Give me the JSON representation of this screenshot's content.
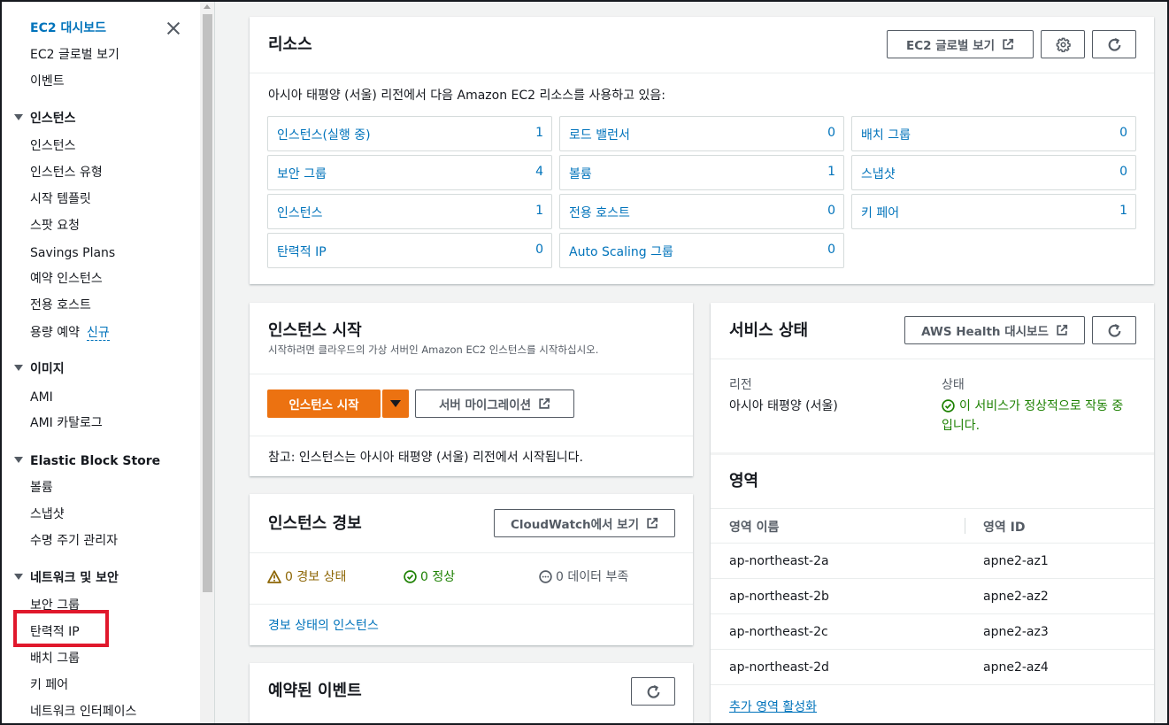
{
  "sidebar": {
    "items_top": [
      "EC2 대시보드",
      "EC2 글로벌 보기",
      "이벤트"
    ],
    "sections": [
      {
        "title": "인스턴스",
        "items": [
          "인스턴스",
          "인스턴스 유형",
          "시작 템플릿",
          "스팟 요청",
          "Savings Plans",
          "예약 인스턴스",
          "전용 호스트",
          "용량 예약"
        ]
      },
      {
        "title": "이미지",
        "items": [
          "AMI",
          "AMI 카탈로그"
        ]
      },
      {
        "title": "Elastic Block Store",
        "items": [
          "볼륨",
          "스냅샷",
          "수명 주기 관리자"
        ]
      },
      {
        "title": "네트워크 및 보안",
        "items": [
          "보안 그룹",
          "탄력적 IP",
          "배치 그룹",
          "키 페어",
          "네트워크 인터페이스"
        ]
      }
    ],
    "new_badge": "신규"
  },
  "resources": {
    "title": "리소스",
    "global_view_button": "EC2 글로벌 보기",
    "description": "아시아 태평양 (서울) 리전에서 다음 Amazon EC2 리소스를 사용하고 있음:",
    "items": [
      {
        "label": "인스턴스(실행 중)",
        "count": "1"
      },
      {
        "label": "로드 밸런서",
        "count": "0"
      },
      {
        "label": "배치 그룹",
        "count": "0"
      },
      {
        "label": "보안 그룹",
        "count": "4"
      },
      {
        "label": "볼륨",
        "count": "1"
      },
      {
        "label": "스냅샷",
        "count": "0"
      },
      {
        "label": "인스턴스",
        "count": "1"
      },
      {
        "label": "전용 호스트",
        "count": "0"
      },
      {
        "label": "키 페어",
        "count": "1"
      },
      {
        "label": "탄력적 IP",
        "count": "0"
      },
      {
        "label": "Auto Scaling 그룹",
        "count": "0"
      }
    ]
  },
  "launch": {
    "title": "인스턴스 시작",
    "subtitle": "시작하려면 클라우드의 가상 서버인 Amazon EC2 인스턴스를 시작하십시오.",
    "launch_button": "인스턴스 시작",
    "migrate_button": "서버 마이그레이션",
    "note": "참고: 인스턴스는 아시아 태평양 (서울) 리전에서 시작됩니다."
  },
  "alarms": {
    "title": "인스턴스 경보",
    "cloudwatch_button": "CloudWatch에서 보기",
    "alarm_state": "0 경보 상태",
    "ok_state": "0 정상",
    "insufficient_state": "0 데이터 부족",
    "alarm_link": "경보 상태의 인스턴스"
  },
  "events": {
    "title": "예약된 이벤트"
  },
  "service": {
    "title": "서비스 상태",
    "health_button": "AWS Health 대시보드",
    "region_label": "리전",
    "region_value": "아시아 태평양 (서울)",
    "status_label": "상태",
    "status_line1": "이 서비스가 정상적으로 작동 중",
    "status_line2": "입니다.",
    "zones_title": "영역",
    "zone_name_header": "영역 이름",
    "zone_id_header": "영역 ID",
    "zones": [
      {
        "name": "ap-northeast-2a",
        "id": "apne2-az1"
      },
      {
        "name": "ap-northeast-2b",
        "id": "apne2-az2"
      },
      {
        "name": "ap-northeast-2c",
        "id": "apne2-az3"
      },
      {
        "name": "ap-northeast-2d",
        "id": "apne2-az4"
      }
    ],
    "enable_zones_link": "추가 영역 활성화"
  },
  "colors": {
    "accent": "#0073bb",
    "primary_button": "#ec7211",
    "success": "#1d8102",
    "warning": "#8d6605",
    "highlight": "#e0182c"
  }
}
